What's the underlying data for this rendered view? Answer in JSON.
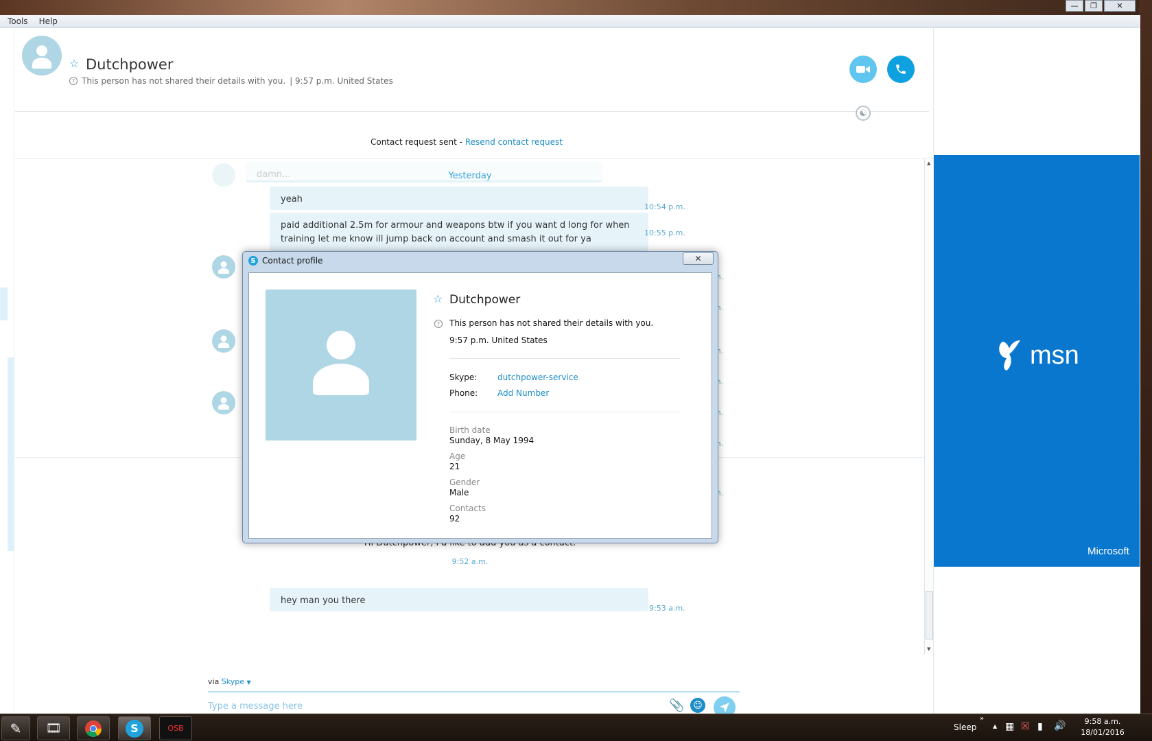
{
  "menu": {
    "tools": "Tools",
    "help": "Help"
  },
  "contact": {
    "name": "Dutchpower",
    "status": "This person has not shared their details with you.",
    "time_loc": "| 9:57 p.m. United States"
  },
  "request": {
    "sent": "Contact request sent - ",
    "resend": "Resend contact request"
  },
  "chat": {
    "day_label": "Yesterday",
    "faded_text": "damn...",
    "messages": [
      {
        "text": "yeah",
        "time": "10:54 p.m."
      },
      {
        "text": "paid additional 2.5m for armour and weapons btw if you want d long for when training let me know ill jump back on account and smash it out for ya",
        "time": "10:55 p.m."
      },
      {
        "text": "hey man you there",
        "time": "9:53 a.m."
      }
    ],
    "partial_times": [
      "m.",
      "m.",
      "m.",
      "m.",
      "m.",
      "m.",
      "m."
    ],
    "request_msg": "Hi Dutchpower, I'd like to add you as a contact.",
    "request_time": "9:52 a.m."
  },
  "compose": {
    "via": "via ",
    "service": "Skype",
    "placeholder": "Type a message here"
  },
  "ad": {
    "brand": "msn",
    "company": "Microsoft"
  },
  "dialog": {
    "title": "Contact profile",
    "name": "Dutchpower",
    "status": "This person has not shared their details with you.",
    "time_loc": "9:57 p.m. United States",
    "skype_label": "Skype:",
    "skype_value": "dutchpower-service",
    "phone_label": "Phone:",
    "phone_value": "Add Number",
    "birth_label": "Birth date",
    "birth_value": "Sunday, 8 May 1994",
    "age_label": "Age",
    "age_value": "21",
    "gender_label": "Gender",
    "gender_value": "Male",
    "contacts_label": "Contacts",
    "contacts_value": "92"
  },
  "taskbar": {
    "sleep": "Sleep",
    "clock_time": "9:58 a.m.",
    "clock_date": "18/01/2016",
    "osb": "OSB"
  },
  "colors": {
    "accent": "#1d8dc8",
    "bubble": "#e6f4fa",
    "msn_blue": "#0a77cf",
    "avatar": "#aed6e4"
  },
  "icons": [
    "star-icon",
    "help-icon",
    "video-call-icon",
    "phone-call-icon",
    "globe-icon",
    "attach-icon",
    "emoticon-icon",
    "send-icon",
    "skype-icon",
    "close-icon"
  ]
}
